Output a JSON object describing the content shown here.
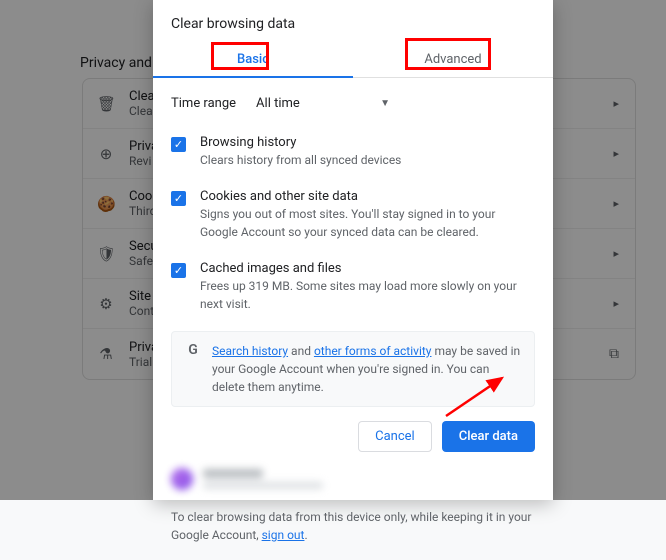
{
  "bg": {
    "section_title": "Privacy and s",
    "items": [
      {
        "icon": "🗑",
        "title": "Clear",
        "sub": "Clear"
      },
      {
        "icon": "⊕",
        "title": "Priva",
        "sub": "Revi"
      },
      {
        "icon": "🍪",
        "title": "Cook",
        "sub": "Third"
      },
      {
        "icon": "🛡",
        "title": "Secu",
        "sub": "Safe"
      },
      {
        "icon": "⚙",
        "title": "Site",
        "sub": "Cont"
      },
      {
        "icon": "⚗",
        "title": "Priva",
        "sub": "Trial"
      }
    ]
  },
  "dialog": {
    "title": "Clear browsing data",
    "tabs": {
      "basic": "Basic",
      "advanced": "Advanced"
    },
    "time_range_label": "Time range",
    "time_range_value": "All time",
    "options": [
      {
        "title": "Browsing history",
        "sub": "Clears history from all synced devices"
      },
      {
        "title": "Cookies and other site data",
        "sub": "Signs you out of most sites. You'll stay signed in to your Google Account so your synced data can be cleared."
      },
      {
        "title": "Cached images and files",
        "sub": "Frees up 319 MB. Some sites may load more slowly on your next visit."
      }
    ],
    "info": {
      "link1": "Search history",
      "mid": " and ",
      "link2": "other forms of activity",
      "tail": " may be saved in your Google Account when you're signed in. You can delete them anytime."
    },
    "cancel": "Cancel",
    "clear": "Clear data",
    "footer_pre": "To clear browsing data from this device only, while keeping it in your Google Account, ",
    "footer_link": "sign out",
    "footer_post": "."
  }
}
